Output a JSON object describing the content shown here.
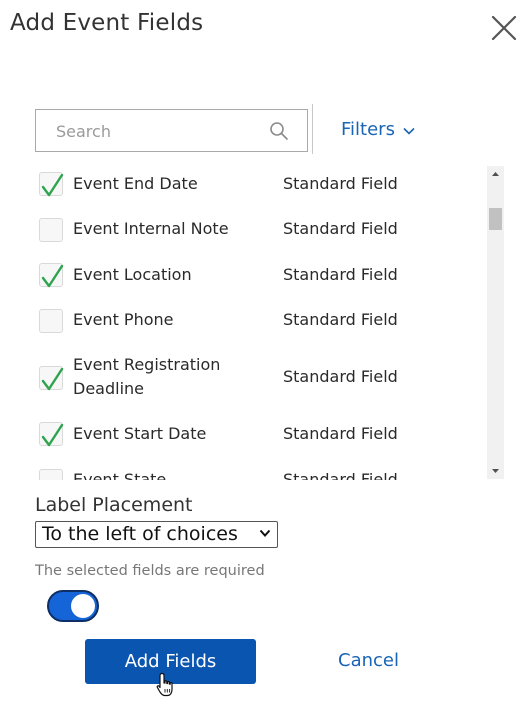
{
  "dialog": {
    "title": "Add Event Fields"
  },
  "search": {
    "placeholder": "Search",
    "value": ""
  },
  "filters": {
    "label": "Filters"
  },
  "fields": [
    {
      "name": "Event End Date",
      "type": "Standard Field",
      "checked": true
    },
    {
      "name": "Event Internal Note",
      "type": "Standard Field",
      "checked": false
    },
    {
      "name": "Event Location",
      "type": "Standard Field",
      "checked": true
    },
    {
      "name": "Event Phone",
      "type": "Standard Field",
      "checked": false
    },
    {
      "name": "Event Registration Deadline",
      "type": "Standard Field",
      "checked": true
    },
    {
      "name": "Event Start Date",
      "type": "Standard Field",
      "checked": true
    },
    {
      "name": "Event State",
      "type": "Standard Field",
      "checked": false
    }
  ],
  "label_placement": {
    "label": "Label Placement",
    "selected": "To the left of choices"
  },
  "required": {
    "label": "The selected fields are required",
    "on": true
  },
  "actions": {
    "add_label": "Add Fields",
    "cancel_label": "Cancel"
  },
  "colors": {
    "accent": "#1a64b4",
    "primary_button": "#0a55b0",
    "toggle_on": "#1565d8",
    "check": "#2ea44f"
  }
}
